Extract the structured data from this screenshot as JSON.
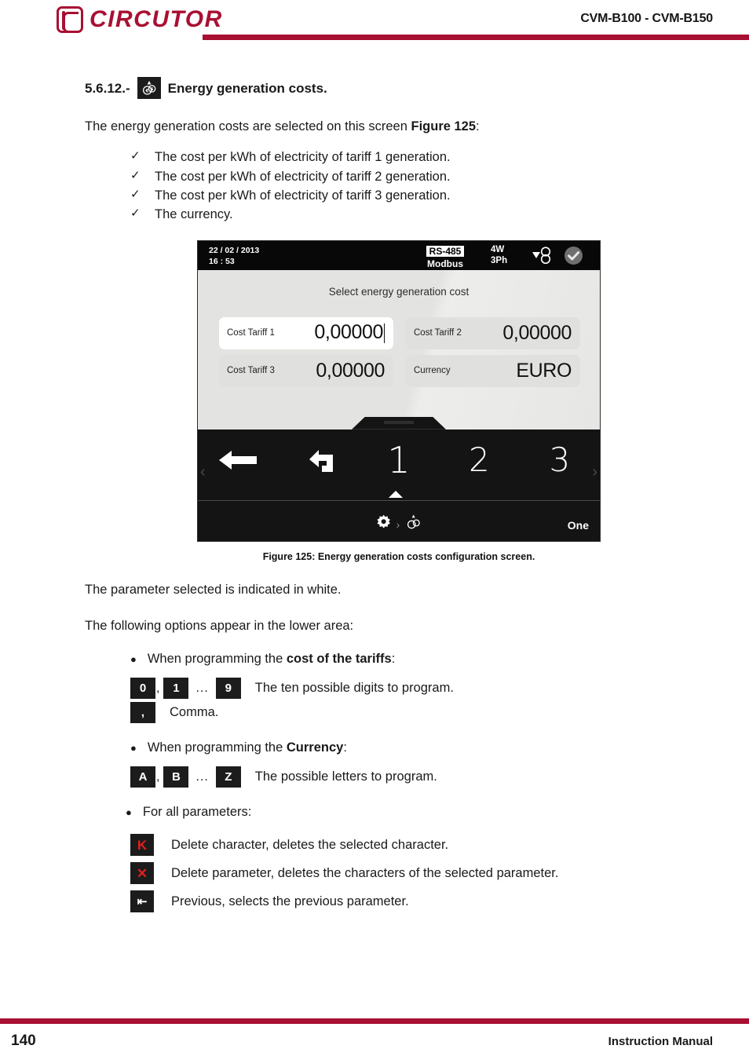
{
  "header": {
    "logo_text": "CIRCUTOR",
    "logo_icon": "circutor-c-logo",
    "title": "CVM-B100 - CVM-B150",
    "accent_color": "#A81033"
  },
  "section": {
    "number": "5.6.12.-",
    "icon": "coins-icon",
    "title": "Energy generation costs.",
    "intro_before": "The energy generation costs are selected on this screen ",
    "intro_bold": "Figure 125",
    "intro_after": ":",
    "checklist": [
      "The cost per kWh of electricity of tariff 1 generation.",
      "The cost per kWh of electricity of tariff 2 generation.",
      "The cost per kWh of electricity of tariff 3 generation.",
      "The currency."
    ]
  },
  "device": {
    "status": {
      "date": "22 / 02 / 2013",
      "time": "16 : 53",
      "bus_protocol": "RS-485",
      "bus_mode": "Modbus",
      "wiring_top": "4W",
      "wiring_bottom": "3Ph",
      "energy_icon": "energy-flow-icon",
      "ok_icon": "check-circle-icon"
    },
    "screen_heading": "Select energy generation cost",
    "fields": [
      {
        "label": "Cost Tariff 1",
        "value": "0,00000",
        "selected": true
      },
      {
        "label": "Cost Tariff 2",
        "value": "0,00000",
        "selected": false
      },
      {
        "label": "Cost Tariff 3",
        "value": "0,00000",
        "selected": false
      },
      {
        "label": "Currency",
        "value": "EURO",
        "selected": false
      }
    ],
    "nav": {
      "left_chevron": "‹",
      "right_chevron": "›",
      "back_arrow_icon": "left-arrow-icon",
      "return_icon": "undo-arrow-icon",
      "items": [
        {
          "label": "1",
          "active": true
        },
        {
          "label": "2",
          "active": false
        },
        {
          "label": "3",
          "active": false
        }
      ]
    },
    "breadcrumb": {
      "gear_icon": "gear-icon",
      "separator": "›",
      "coins_icon": "coins-icon",
      "mode": "One"
    }
  },
  "figure": {
    "caption": "Figure 125: Energy generation costs configuration screen."
  },
  "notes": {
    "selected_param": "The parameter selected is indicated in white.",
    "lower_area": "The following options appear in the lower area:",
    "bullet_tariffs_before": "When programming the ",
    "bullet_tariffs_bold": "cost of the tariffs",
    "bullet_tariffs_after": ":",
    "bullet_currency_before": "When programming the ",
    "bullet_currency_bold": "Currency",
    "bullet_currency_after": ":",
    "bullet_all": "For all parameters:"
  },
  "keys": {
    "digits": {
      "first": "0",
      "second": "1",
      "ellipsis": "...",
      "last": "9",
      "comma_after_first": ",",
      "desc": "The ten possible digits to program."
    },
    "comma": {
      "glyph": ",",
      "desc": "Comma."
    },
    "letters": {
      "first": "A",
      "second": "B",
      "ellipsis": "...",
      "last": "Z",
      "comma_after_first": ",",
      "desc": "The possible letters to program."
    },
    "actions": [
      {
        "icon": "delete-character-icon",
        "glyph": "K",
        "color": "#e02020",
        "desc": "Delete character, deletes the selected character."
      },
      {
        "icon": "delete-parameter-icon",
        "glyph": "✕",
        "color": "#e02020",
        "desc": "Delete parameter, deletes the characters of the selected parameter."
      },
      {
        "icon": "previous-parameter-icon",
        "glyph": "⇤",
        "color": "#ffffff",
        "desc": "Previous, selects the previous parameter."
      }
    ]
  },
  "footer": {
    "page_number": "140",
    "label": "Instruction Manual"
  }
}
